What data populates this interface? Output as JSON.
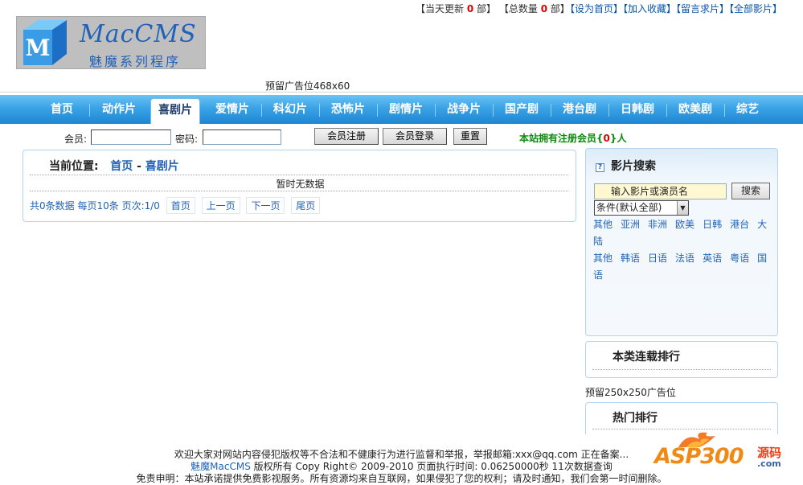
{
  "top_stats": {
    "today_prefix": "【当天更新",
    "today_count": "0",
    "today_suffix": "部】",
    "total_prefix": "【总数量",
    "total_count": "0",
    "total_suffix": "部】",
    "links": [
      "【设为首页】",
      "【加入收藏】",
      "【留言求片】",
      "【全部影片】"
    ]
  },
  "logo": {
    "brand": "MacCMS",
    "subtitle": "魅魔系列程序",
    "cube_letter": "M"
  },
  "ad_top": "预留广告位468x60",
  "nav": {
    "items": [
      "首页",
      "动作片",
      "喜剧片",
      "爱情片",
      "科幻片",
      "恐怖片",
      "剧情片",
      "战争片",
      "国产剧",
      "港台剧",
      "日韩剧",
      "欧美剧",
      "综艺"
    ],
    "active_index": 2
  },
  "login": {
    "member_label": "会员:",
    "password_label": "密码:",
    "register_button": "会员注册",
    "login_button": "会员登录",
    "reset_button": "重置",
    "member_count_prefix": "本站拥有注册会员{",
    "member_count": "0",
    "member_count_suffix": "}人"
  },
  "main": {
    "crumb_label": "当前位置:",
    "crumb_home": "首页",
    "crumb_sep": " - ",
    "crumb_current": "喜剧片",
    "empty_text": "暂时无数据",
    "pager": {
      "total": "共0条数据",
      "per_page": "每页10条",
      "page_info": "页次:1/0",
      "first": "首页",
      "prev": "上一页",
      "next": "下一页",
      "last": "尾页"
    }
  },
  "sidebar": {
    "search_title": "影片搜索",
    "search_input": "输入影片或演员名",
    "search_button": "搜索",
    "filter_selected": "条件(默认全部)",
    "regions": [
      "其他",
      "亚洲",
      "非洲",
      "欧美",
      "日韩",
      "港台",
      "大陆"
    ],
    "languages": [
      "其他",
      "韩语",
      "日语",
      "法语",
      "英语",
      "粤语",
      "国语"
    ],
    "ranking_title": "本类连载排行",
    "ad_250": "预留250x250广告位",
    "hot_title": "热门排行"
  },
  "footer": {
    "line1": "欢迎大家对网站内容侵犯版权等不合法和不健康行为进行监督和举报，举报邮箱:xxx@qq.com  正在备案...",
    "brand": "魅魔MacCMS",
    "line2_rest": " 版权所有  Copy Right© 2009-2010 页面执行时间: 0.06250000秒  11次数据查询",
    "line3": "免责申明：本站承诺提供免费影视服务。所有资源均来自互联网，如果侵犯了您的权利；请及时通知，我们会第一时间删除。"
  },
  "watermark": {
    "text": "ASP300",
    "cn": "源码",
    "domain": ".com"
  },
  "colors": {
    "nav_blue": "#2a93dc",
    "link_blue": "#1f62b8",
    "count_red": "#dd0000",
    "member_green": "#0b8a0b"
  }
}
